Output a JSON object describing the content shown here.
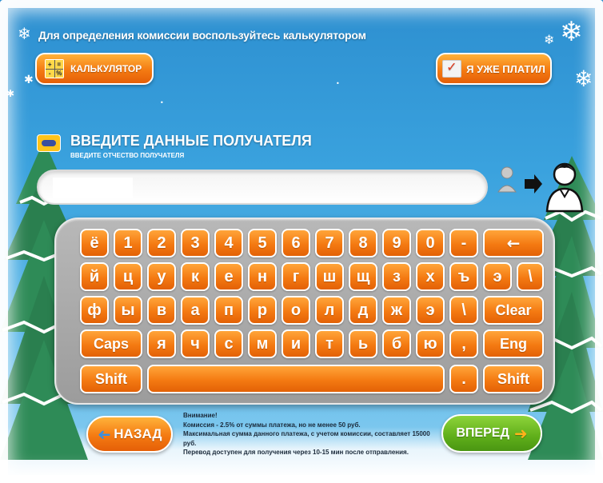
{
  "top": {
    "hint": "Для определения комиссии воспользуйтесь калькулятором",
    "calculator_label": "КАЛЬКУЛЯТОР",
    "already_paid_label": "Я УЖЕ ПЛАТИЛ"
  },
  "section": {
    "title": "ВВЕДИТЕ ДАННЫЕ ПОЛУЧАТЕЛЯ",
    "subtitle": "ВВЕДИТЕ ОТЧЕСТВО ПОЛУЧАТЕЛЯ"
  },
  "input": {
    "value": ""
  },
  "keyboard": {
    "row1": [
      "ё",
      "1",
      "2",
      "3",
      "4",
      "5",
      "6",
      "7",
      "8",
      "9",
      "0",
      "-",
      "←"
    ],
    "row2": [
      "й",
      "ц",
      "у",
      "к",
      "е",
      "н",
      "г",
      "ш",
      "щ",
      "з",
      "х",
      "ъ",
      "э",
      "\\"
    ],
    "row3": [
      "ф",
      "ы",
      "в",
      "а",
      "п",
      "р",
      "о",
      "л",
      "д",
      "ж",
      "э",
      "\\",
      "Clear"
    ],
    "row4": [
      "Caps",
      "я",
      "ч",
      "с",
      "м",
      "и",
      "т",
      "ь",
      "б",
      "ю",
      ",",
      "Eng"
    ],
    "row5": [
      "Shift",
      "",
      ".",
      "Shift"
    ]
  },
  "nav": {
    "back_label": "НАЗАД",
    "forward_label": "ВПЕРЕД"
  },
  "notice": {
    "heading": "Внимание!",
    "line1": "Комиссия - 2.5% от суммы платежа, но не менее 50 руб.",
    "line2": "Максимальная сумма данного платежа, с учетом комиссии, составляет 15000 руб.",
    "line3": "Перевод доступен для получения через 10-15 мин после отправления."
  },
  "colors": {
    "accent_orange": "#f47a12",
    "accent_green": "#5fae1a",
    "background_blue": "#3aa2de"
  }
}
